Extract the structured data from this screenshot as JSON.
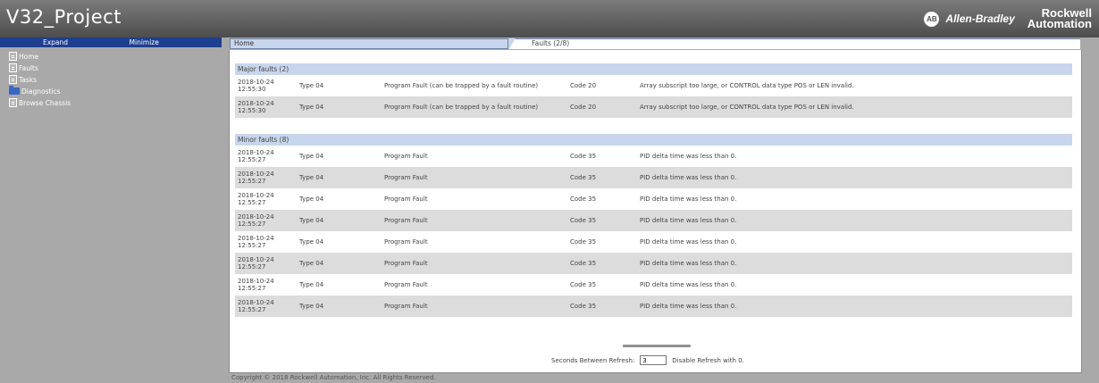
{
  "app": {
    "title": "V32_Project",
    "brand_ab": "Allen-Bradley",
    "brand_ra_line1": "Rockwell",
    "brand_ra_line2": "Automation"
  },
  "sidebar": {
    "expand_label": "Expand",
    "minimize_label": "Minimize",
    "items": [
      {
        "label": "Home",
        "icon": "page-icon"
      },
      {
        "label": "Faults",
        "icon": "page-icon"
      },
      {
        "label": "Tasks",
        "icon": "page-icon"
      },
      {
        "label": "Diagnostics",
        "icon": "folder-icon"
      },
      {
        "label": "Browse Chassis",
        "icon": "page-icon"
      }
    ]
  },
  "tabs": {
    "home": "Home",
    "faults": "Faults (2/8)"
  },
  "major": {
    "heading": "Major faults (2)",
    "rows": [
      {
        "date": "2018-10-24",
        "time": "12:55:30",
        "type": "Type 04",
        "desc": "Program Fault (can be trapped by a fault routine)",
        "code": "Code 20",
        "msg": "Array subscript too large, or CONTROL data type POS or LEN invalid."
      },
      {
        "date": "2018-10-24",
        "time": "12:55:30",
        "type": "Type 04",
        "desc": "Program Fault (can be trapped by a fault routine)",
        "code": "Code 20",
        "msg": "Array subscript too large, or CONTROL data type POS or LEN invalid."
      }
    ]
  },
  "minor": {
    "heading": "Minor faults (8)",
    "rows": [
      {
        "date": "2018-10-24",
        "time": "12:55:27",
        "type": "Type 04",
        "desc": "Program Fault",
        "code": "Code 35",
        "msg": "PID delta time was less than 0."
      },
      {
        "date": "2018-10-24",
        "time": "12:55:27",
        "type": "Type 04",
        "desc": "Program Fault",
        "code": "Code 35",
        "msg": "PID delta time was less than 0."
      },
      {
        "date": "2018-10-24",
        "time": "12:55:27",
        "type": "Type 04",
        "desc": "Program Fault",
        "code": "Code 35",
        "msg": "PID delta time was less than 0."
      },
      {
        "date": "2018-10-24",
        "time": "12:55:27",
        "type": "Type 04",
        "desc": "Program Fault",
        "code": "Code 35",
        "msg": "PID delta time was less than 0."
      },
      {
        "date": "2018-10-24",
        "time": "12:55:27",
        "type": "Type 04",
        "desc": "Program Fault",
        "code": "Code 35",
        "msg": "PID delta time was less than 0."
      },
      {
        "date": "2018-10-24",
        "time": "12:55:27",
        "type": "Type 04",
        "desc": "Program Fault",
        "code": "Code 35",
        "msg": "PID delta time was less than 0."
      },
      {
        "date": "2018-10-24",
        "time": "12:55:27",
        "type": "Type 04",
        "desc": "Program Fault",
        "code": "Code 35",
        "msg": "PID delta time was less than 0."
      },
      {
        "date": "2018-10-24",
        "time": "12:55:27",
        "type": "Type 04",
        "desc": "Program Fault",
        "code": "Code 35",
        "msg": "PID delta time was less than 0."
      }
    ]
  },
  "refresh": {
    "label": "Seconds Between Refresh:",
    "value": "3",
    "hint": "Disable Refresh with 0."
  },
  "footer": {
    "copyright": "Copyright © 2018 Rockwell Automation, Inc. All Rights Reserved."
  },
  "colors": {
    "header_bg": "#5c5c5c",
    "sidebar_head": "#1c3f8f",
    "group_head": "#c7d6ec",
    "alt_row": "#dcdcdc"
  }
}
